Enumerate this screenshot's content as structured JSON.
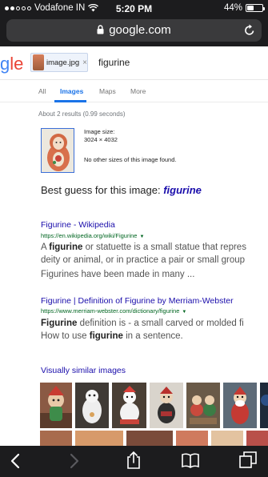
{
  "status": {
    "carrier": "Vodafone IN",
    "time": "5:20 PM",
    "battery": "44%",
    "battery_level": 0.44
  },
  "browser": {
    "url": "google.com"
  },
  "search": {
    "logo_text": "gle",
    "chip_filename": "image.jpg",
    "chip_close": "×",
    "query": "figurine"
  },
  "tabs": [
    "All",
    "Images",
    "Maps",
    "More"
  ],
  "active_tab": "Images",
  "results_count": "About 2 results (0.99 seconds)",
  "image_info": {
    "size_label": "Image size:",
    "size_value": "3024 × 4032",
    "other_sizes": "No other sizes of this image found."
  },
  "best_guess": {
    "prefix": "Best guess for this image:",
    "term": "figurine"
  },
  "results": [
    {
      "title": "Figurine - Wikipedia",
      "url": "https://en.wikipedia.org/wiki/Figurine",
      "snippet": [
        [
          "A ",
          "figurine",
          " or statuette is a small statue that repres"
        ],
        [
          "deity or animal, or in practice a pair or small group"
        ],
        [
          "Figurines have been made in many ..."
        ]
      ]
    },
    {
      "title": "Figurine | Definition of Figurine by Merriam-Webster",
      "url": "https://www.merriam-webster.com/dictionary/figurine",
      "snippet": [
        [
          "",
          "Figurine",
          " definition is - a small carved or molded fi"
        ],
        [
          "How to use ",
          "figurine",
          " in a sentence."
        ]
      ]
    }
  ],
  "visually_similar": "Visually similar images",
  "colors": {
    "link": "#1a0dab",
    "url_green": "#006621",
    "accent": "#1a73e8",
    "chrome": "#1c1c1e"
  },
  "toolbar_icons": [
    "back-icon",
    "forward-icon",
    "share-icon",
    "bookmarks-icon",
    "tabs-icon"
  ]
}
